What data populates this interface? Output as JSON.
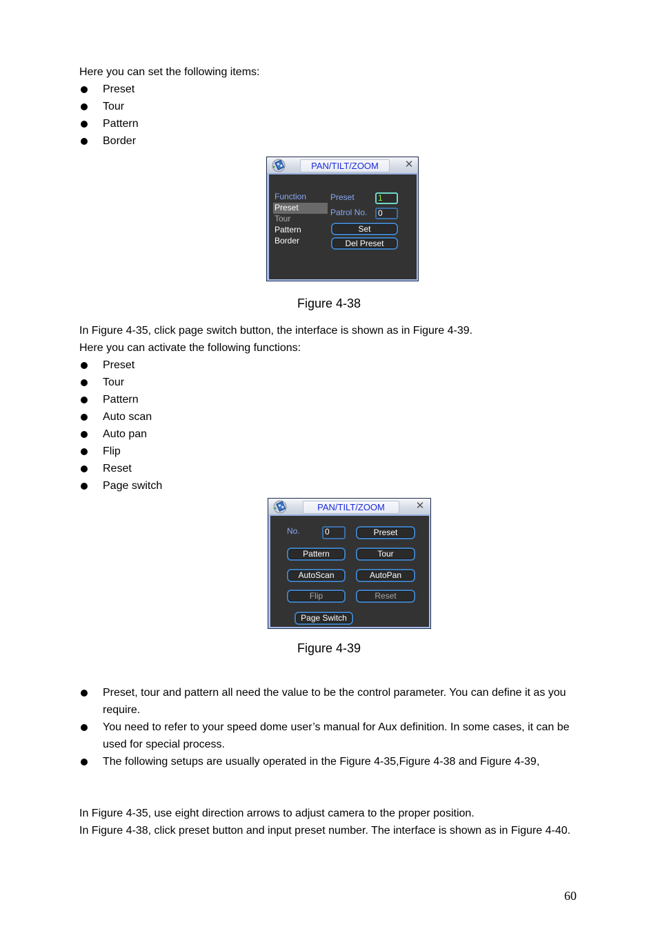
{
  "intro1": "Here you can set the following items:",
  "list1": [
    "Preset",
    "Tour",
    "Pattern",
    "Border"
  ],
  "fig38": {
    "title": "PAN/TILT/ZOOM",
    "close_glyph": "✕",
    "menu_header": "Function",
    "menu_items": [
      "Preset",
      "Tour",
      "Pattern",
      "Border"
    ],
    "selected_item": "Preset",
    "preset_label": "Preset",
    "preset_value": "1",
    "patrol_label": "Patrol No.",
    "patrol_value": "0",
    "set_label": "Set",
    "del_preset_label": "Del Preset",
    "colors": {
      "menu_header": "#8aa8f0",
      "selected_bg": "#6a6a6a",
      "active_input_text": "#9cf03c"
    }
  },
  "caption38": "Figure 4-38",
  "para2": "In  Figure 4-35,  click page switch button, the interface is shown as in Figure 4-39.",
  "intro2": "Here you can activate the following functions:",
  "list2": [
    "Preset",
    "Tour",
    "Pattern",
    "Auto scan",
    "Auto pan",
    "Flip",
    "Reset",
    "Page switch"
  ],
  "fig39": {
    "title": "PAN/TILT/ZOOM",
    "close_glyph": "✕",
    "no_label": "No.",
    "no_value": "0",
    "preset_label": "Preset",
    "pattern_label": "Pattern",
    "tour_label": "Tour",
    "autoscan_label": "AutoScan",
    "autopan_label": "AutoPan",
    "flip_label": "Flip",
    "reset_label": "Reset",
    "page_switch_label": "Page Switch"
  },
  "caption39": "Figure 4-39",
  "notes": [
    "Preset, tour and pattern all need the value to be the control parameter. You can define it as you require.",
    "You need to refer to your speed dome user’s manual for Aux definition. In some cases, it can be used for special process.",
    "The following setups are usually operated in the Figure 4-35,Figure 4-38 and Figure 4-39,"
  ],
  "para3": "In Figure 4-35, use eight direction arrows to adjust camera to the proper position.",
  "para4": "In  Figure 4-38, click preset button and input preset number. The interface is shown as in Figure 4-40.",
  "page_number": "60"
}
